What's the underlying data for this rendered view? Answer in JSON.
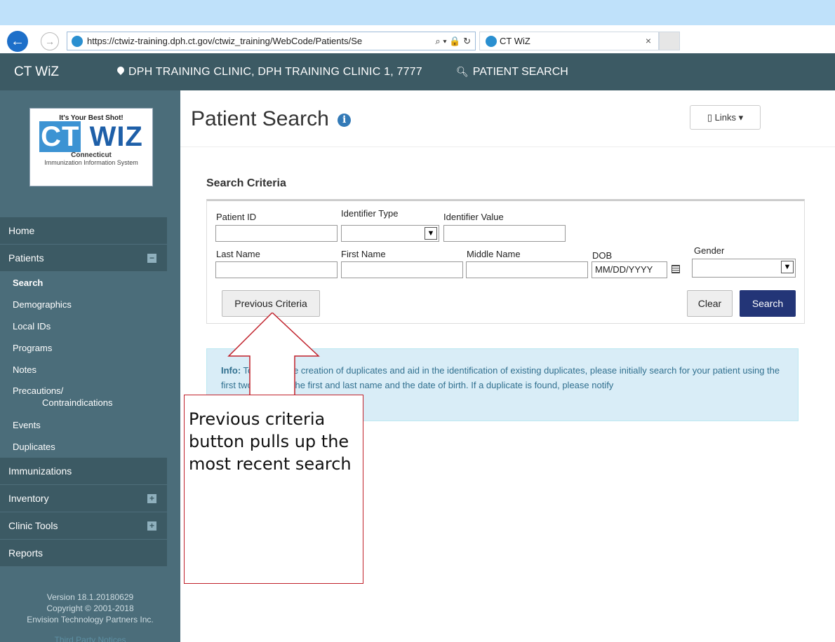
{
  "browser": {
    "url": "https://ctwiz-training.dph.ct.gov/ctwiz_training/WebCode/Patients/Se",
    "url_tools": "⌕ ▾ 🔒 ↻",
    "tab_title": "CT WiZ",
    "tab_close": "×"
  },
  "header": {
    "brand": "CT WiZ",
    "clinic": "DPH TRAINING CLINIC, DPH TRAINING CLINIC 1, 7777",
    "patient_search": "PATIENT SEARCH"
  },
  "logo": {
    "tagline": "It's Your Best Shot!",
    "ct": "CT",
    "wiz": "WIZ",
    "state": "Connecticut",
    "system": "Immunization Information System"
  },
  "sidebar": {
    "home": "Home",
    "patients": "Patients",
    "patients_toggle": "−",
    "patients_sub": {
      "search": "Search",
      "demographics": "Demographics",
      "local_ids": "Local IDs",
      "programs": "Programs",
      "notes": "Notes",
      "precautions_1": "Precautions/",
      "precautions_2": "Contraindications",
      "events": "Events",
      "duplicates": "Duplicates"
    },
    "immunizations": "Immunizations",
    "inventory": "Inventory",
    "inventory_toggle": "+",
    "clinic_tools": "Clinic Tools",
    "clinic_tools_toggle": "+",
    "reports": "Reports",
    "version": "Version 18.1.20180629",
    "copyright": "Copyright © 2001-2018",
    "company": "Envision Technology Partners Inc.",
    "third_party": "Third Party Notices"
  },
  "main": {
    "title": "Patient Search",
    "info_icon": "i",
    "links_label": "Links ▾",
    "search_criteria_title": "Search Criteria",
    "fields": {
      "patient_id": "Patient ID",
      "identifier_type": "Identifier Type",
      "identifier_value": "Identifier Value",
      "last_name": "Last Name",
      "first_name": "First Name",
      "middle_name": "Middle Name",
      "dob": "DOB",
      "dob_placeholder": "MM/DD/YYYY",
      "gender": "Gender"
    },
    "buttons": {
      "previous_criteria": "Previous Criteria",
      "clear": "Clear",
      "search": "Search"
    },
    "info_label": "Info:",
    "info_text": " To reduce the creation of duplicates and aid in the identification of existing duplicates, please initially search for your patient using the first two letters of the first and last name and the date of birth. If a duplicate is found, please notify"
  },
  "annotation": {
    "text": "Previous criteria button pulls up the most recent search"
  },
  "colors": {
    "header_bg": "#3c5a64",
    "sidebar_bg": "#4b6d7a",
    "search_button": "#233577",
    "info_bg": "#d9edf7",
    "annotation_border": "#c0202a"
  }
}
